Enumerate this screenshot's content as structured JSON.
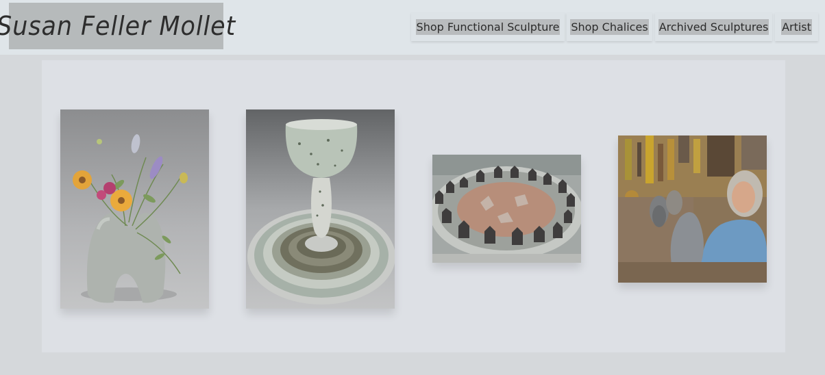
{
  "header": {
    "logo_text": "Susan Feller Mollet"
  },
  "nav": {
    "items": [
      {
        "label": "Shop Functional Sculpture"
      },
      {
        "label": "Shop Chalices"
      },
      {
        "label": "Archived Sculptures"
      },
      {
        "label": "Artist"
      }
    ]
  },
  "gallery": {
    "images": [
      {
        "icon": "flower-vase-sculpture-image"
      },
      {
        "icon": "chalice-and-plate-image"
      },
      {
        "icon": "circle-of-houses-sculpture-image"
      },
      {
        "icon": "artist-portrait-image"
      }
    ]
  },
  "colors": {
    "page_background": "#d5d8db",
    "header_background": "#dfe5e9",
    "logo_background": "#b6babb",
    "nav_highlight": "#b9bcbe",
    "panel_background": "#dde0e5"
  }
}
